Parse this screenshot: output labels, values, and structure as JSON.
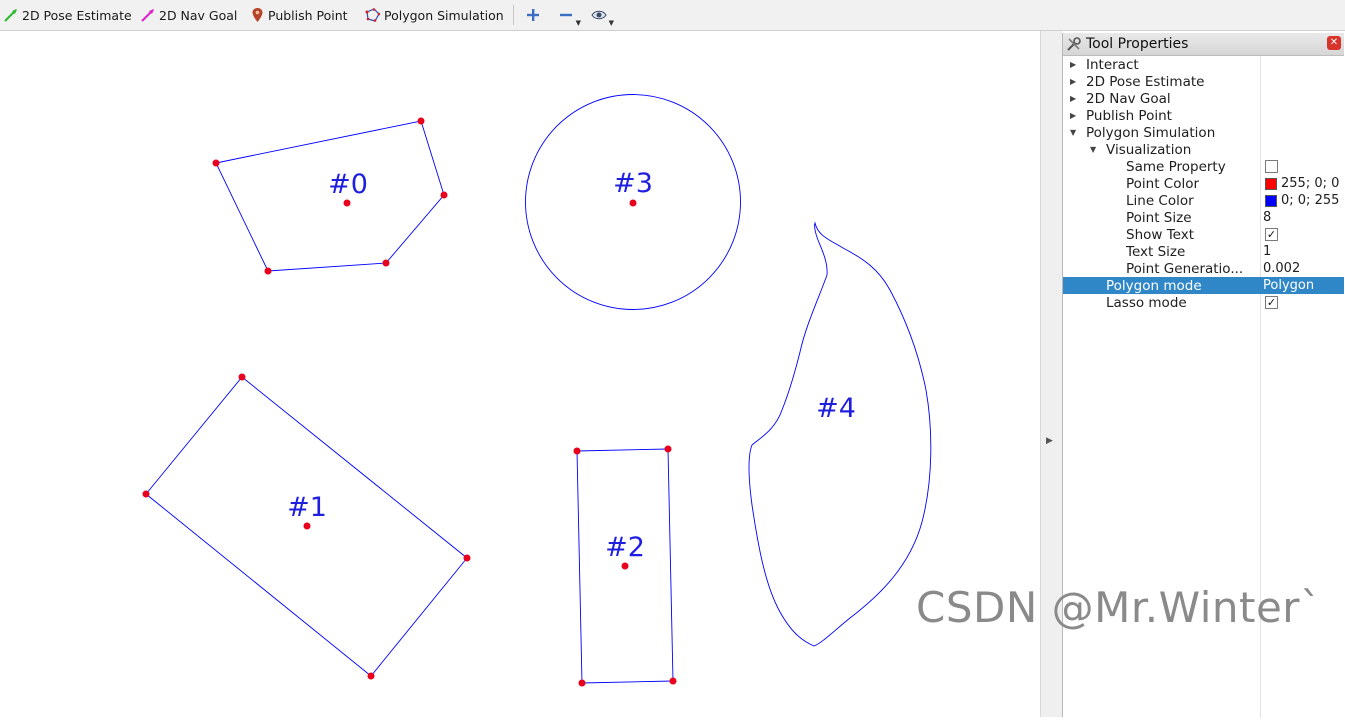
{
  "toolbar": {
    "tools": [
      {
        "label": "2D Pose Estimate",
        "icon": "green-arrow-icon"
      },
      {
        "label": "2D Nav Goal",
        "icon": "magenta-arrow-icon"
      },
      {
        "label": "Publish Point",
        "icon": "map-pin-icon"
      },
      {
        "label": "Polygon Simulation",
        "icon": "polygon-icon"
      }
    ],
    "view_buttons": [
      "plus-icon",
      "minus-icon",
      "eye-icon"
    ]
  },
  "canvas": {
    "point_color": "#e8001c",
    "line_color": "#0000ff",
    "label_color": "#1f1fe0",
    "polygons": [
      {
        "label": "#0",
        "kind": "polygon"
      },
      {
        "label": "#1",
        "kind": "polygon"
      },
      {
        "label": "#2",
        "kind": "polygon"
      },
      {
        "label": "#3",
        "kind": "circle"
      },
      {
        "label": "#4",
        "kind": "lasso"
      }
    ]
  },
  "panel": {
    "title": "Tool Properties",
    "items": {
      "interact": "Interact",
      "pose": "2D Pose Estimate",
      "nav": "2D Nav Goal",
      "publish": "Publish Point",
      "polygon_sim": "Polygon Simulation",
      "visualization": "Visualization",
      "same_property": {
        "label": "Same Property",
        "checked": false
      },
      "point_color": {
        "label": "Point Color",
        "value": "255; 0; 0",
        "color": "#ff0000"
      },
      "line_color": {
        "label": "Line Color",
        "value": "0; 0; 255",
        "color": "#0000ff"
      },
      "point_size": {
        "label": "Point Size",
        "value": "8"
      },
      "show_text": {
        "label": "Show Text",
        "checked": true
      },
      "text_size": {
        "label": "Text Size",
        "value": "1"
      },
      "point_generation": {
        "label": "Point Generatio...",
        "value": "0.002"
      },
      "polygon_mode": {
        "label": "Polygon mode",
        "value": "Polygon"
      },
      "lasso_mode": {
        "label": "Lasso mode",
        "checked": true
      }
    }
  },
  "watermark": "CSDN @Mr.Winter`"
}
